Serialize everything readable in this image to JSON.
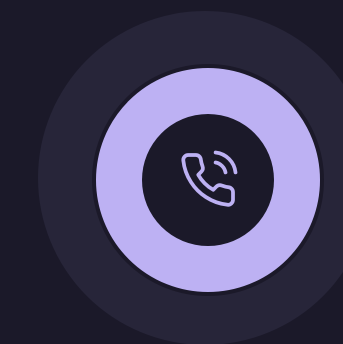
{
  "call_button": {
    "icon": "phone-calling-icon"
  },
  "colors": {
    "background": "#1b1929",
    "halo": "#272539",
    "ring": "#bdb1f3",
    "core": "#1b1929",
    "icon_stroke": "#bdb1f3"
  }
}
